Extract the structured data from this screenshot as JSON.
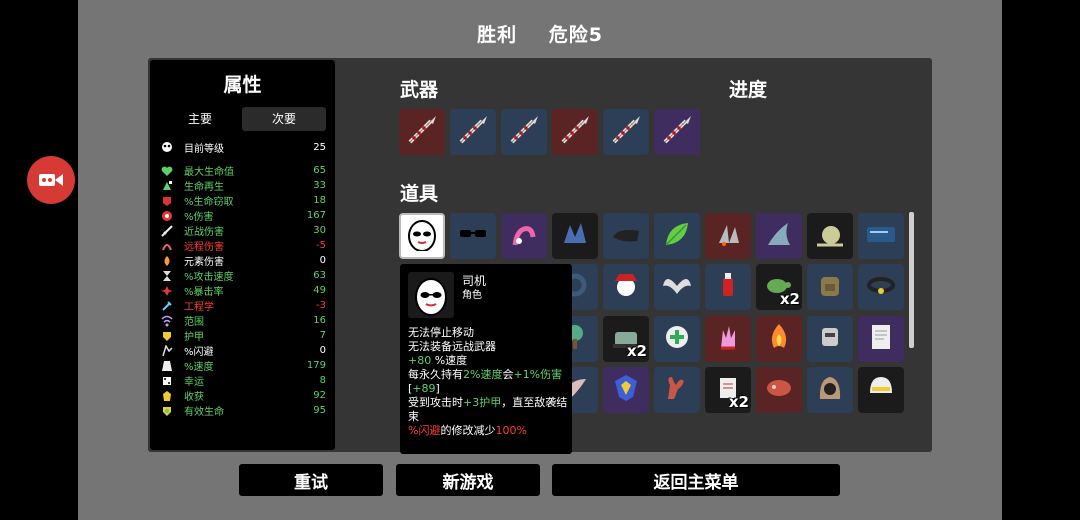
{
  "title": {
    "result": "胜利",
    "danger": "危险5"
  },
  "stats": {
    "title": "属性",
    "tabs": [
      {
        "label": "主要",
        "active": false
      },
      {
        "label": "次要",
        "active": true
      }
    ],
    "level": {
      "label": "目前等级",
      "value": "25"
    },
    "rows": [
      {
        "label": "最大生命值",
        "value": "65",
        "color": "#5ed16a",
        "icon": "heart-icon"
      },
      {
        "label": "生命再生",
        "value": "33",
        "color": "#5ed16a",
        "icon": "regen-icon"
      },
      {
        "label": "%生命窃取",
        "value": "18",
        "color": "#5ed16a",
        "icon": "lifesteal-icon"
      },
      {
        "label": "%伤害",
        "value": "167",
        "color": "#5ed16a",
        "icon": "damage-icon"
      },
      {
        "label": "近战伤害",
        "value": "30",
        "color": "#5ed16a",
        "icon": "melee-icon"
      },
      {
        "label": "远程伤害",
        "value": "-5",
        "color": "#ff3c3c",
        "icon": "ranged-icon"
      },
      {
        "label": "元素伤害",
        "value": "0",
        "color": "#ffffff",
        "icon": "elemental-icon"
      },
      {
        "label": "%攻击速度",
        "value": "63",
        "color": "#5ed16a",
        "icon": "hourglass-icon"
      },
      {
        "label": "%暴击率",
        "value": "49",
        "color": "#5ed16a",
        "icon": "crit-icon"
      },
      {
        "label": "工程学",
        "value": "-3",
        "color": "#ff3c3c",
        "icon": "wrench-icon"
      },
      {
        "label": "范围",
        "value": "16",
        "color": "#5ed16a",
        "icon": "range-icon"
      },
      {
        "label": "护甲",
        "value": "7",
        "color": "#5ed16a",
        "icon": "armor-icon"
      },
      {
        "label": "%闪避",
        "value": "0",
        "color": "#ffffff",
        "icon": "dodge-icon"
      },
      {
        "label": "%速度",
        "value": "179",
        "color": "#5ed16a",
        "icon": "speed-icon"
      },
      {
        "label": "幸运",
        "value": "8",
        "color": "#5ed16a",
        "icon": "luck-icon"
      },
      {
        "label": "收获",
        "value": "92",
        "color": "#5ed16a",
        "icon": "harvest-icon"
      },
      {
        "label": "有效生命",
        "value": "95",
        "color": "#5ed16a",
        "icon": "shield-heart-icon"
      }
    ]
  },
  "weapons": {
    "title": "武器",
    "tiers": [
      "legendary",
      "rare",
      "rare",
      "legendary",
      "rare",
      "epic"
    ],
    "icon": "spear-icon"
  },
  "progress": {
    "title": "进度"
  },
  "items": {
    "title": "道具",
    "rows": [
      [
        {
          "icon": "egg-face-icon",
          "tier": "white"
        },
        {
          "icon": "sunglasses-icon",
          "tier": "rare"
        },
        {
          "icon": "tentacle-icon",
          "tier": "epic"
        },
        {
          "icon": "crystal-icon",
          "tier": "dark"
        },
        {
          "icon": "stone-icon",
          "tier": "rare"
        },
        {
          "icon": "leaf-icon",
          "tier": "rare"
        },
        {
          "icon": "rockets-icon",
          "tier": "legend"
        },
        {
          "icon": "shark-fin-icon",
          "tier": "epic"
        },
        {
          "icon": "snail-icon",
          "tier": "dark"
        },
        {
          "icon": "blue-card-icon",
          "tier": "rare"
        }
      ],
      [
        {
          "icon": "ring-icon",
          "tier": "rare"
        },
        {
          "icon": "pirate-icon",
          "tier": "rare"
        },
        {
          "icon": "wings-icon",
          "tier": "rare"
        },
        {
          "icon": "hot-sauce-icon",
          "tier": "rare"
        },
        {
          "icon": "turtle-icon",
          "tier": "dark",
          "count": "x2"
        },
        {
          "icon": "backpack-icon",
          "tier": "rare"
        },
        {
          "icon": "collar-icon",
          "tier": "rare"
        }
      ],
      [
        {
          "icon": "tree-icon",
          "tier": "rare"
        },
        {
          "icon": "tank-icon",
          "tier": "dark",
          "count": "x2"
        },
        {
          "icon": "medkit-icon",
          "tier": "rare"
        },
        {
          "icon": "claw-hand-icon",
          "tier": "legend"
        },
        {
          "icon": "fire-icon",
          "tier": "legend"
        },
        {
          "icon": "robot-icon",
          "tier": "rare"
        },
        {
          "icon": "scroll-icon",
          "tier": "epic"
        }
      ],
      [
        {
          "icon": "horn-icon",
          "tier": "rare"
        },
        {
          "icon": "blue-shield-icon",
          "tier": "epic"
        },
        {
          "icon": "crab-claw-icon",
          "tier": "rare"
        },
        {
          "icon": "paper-icon",
          "tier": "dark",
          "count": "x2"
        },
        {
          "icon": "meat-icon",
          "tier": "legend"
        },
        {
          "icon": "hooded-icon",
          "tier": "rare"
        },
        {
          "icon": "helmet-icon",
          "tier": "dark"
        }
      ]
    ]
  },
  "tooltip": {
    "name": "司机",
    "type": "角色",
    "line1": "无法停止移动",
    "line2": "无法装备远战武器",
    "line3_a": "+80",
    "line3_b": " %速度",
    "line4_a": "每永久持有",
    "line4_b": "2%速度",
    "line4_c": "会",
    "line4_d": "+1%伤害",
    "line4_e": " [",
    "line4_f": "+89",
    "line4_g": "]",
    "line5_a": "受到攻击时",
    "line5_b": "+3护甲",
    "line5_c": "，直至敌袭结束",
    "line6_a": "%闪避",
    "line6_b": "的修改减少",
    "line6_c": "100%"
  },
  "buttons": {
    "retry": "重试",
    "new_game": "新游戏",
    "main_menu": "返回主菜单"
  }
}
